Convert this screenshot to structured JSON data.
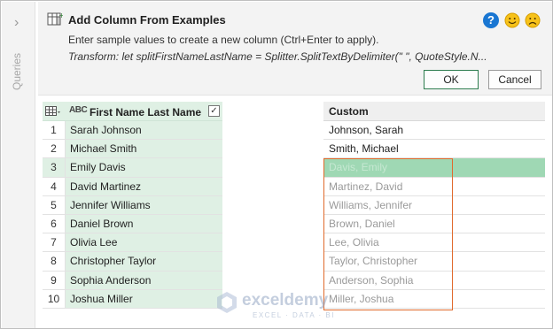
{
  "sidebar": {
    "queries_label": "Queries",
    "collapse_icon": "chevron-right-icon"
  },
  "dialog": {
    "title": "Add Column From Examples",
    "subtitle": "Enter sample values to create a new column (Ctrl+Enter to apply).",
    "transform": "Transform: let splitFirstNameLastName = Splitter.SplitTextByDelimiter(\" \", QuoteStyle.N...",
    "help_icon": "help-icon",
    "help_glyph": "?",
    "ok_label": "OK",
    "cancel_label": "Cancel"
  },
  "source_table": {
    "type_label": "ABC",
    "column_header": "First Name Last Name",
    "checkbox_glyph": "✓",
    "rows": [
      {
        "n": "1",
        "value": "Sarah Johnson"
      },
      {
        "n": "2",
        "value": "Michael Smith"
      },
      {
        "n": "3",
        "value": "Emily Davis"
      },
      {
        "n": "4",
        "value": "David Martinez"
      },
      {
        "n": "5",
        "value": "Jennifer Williams"
      },
      {
        "n": "6",
        "value": "Daniel Brown"
      },
      {
        "n": "7",
        "value": "Olivia Lee"
      },
      {
        "n": "8",
        "value": "Christopher Taylor"
      },
      {
        "n": "9",
        "value": "Sophia Anderson"
      },
      {
        "n": "10",
        "value": "Joshua Miller"
      }
    ]
  },
  "custom_table": {
    "column_header": "Custom",
    "rows": [
      {
        "value": "Johnson, Sarah"
      },
      {
        "value": "Smith, Michael"
      },
      {
        "value": "Davis, Emily"
      },
      {
        "value": "Martinez, David"
      },
      {
        "value": "Williams, Jennifer"
      },
      {
        "value": "Brown, Daniel"
      },
      {
        "value": "Lee, Olivia"
      },
      {
        "value": "Taylor, Christopher"
      },
      {
        "value": "Anderson, Sophia"
      },
      {
        "value": "Miller, Joshua"
      }
    ]
  },
  "watermark": {
    "name": "exceldemy",
    "tagline": "EXCEL · DATA · BI"
  },
  "colors": {
    "accent_green": "#dff0e4",
    "selected_row": "#9fd8b4",
    "highlight_box": "#e06a2c",
    "help_blue": "#1976d2"
  }
}
